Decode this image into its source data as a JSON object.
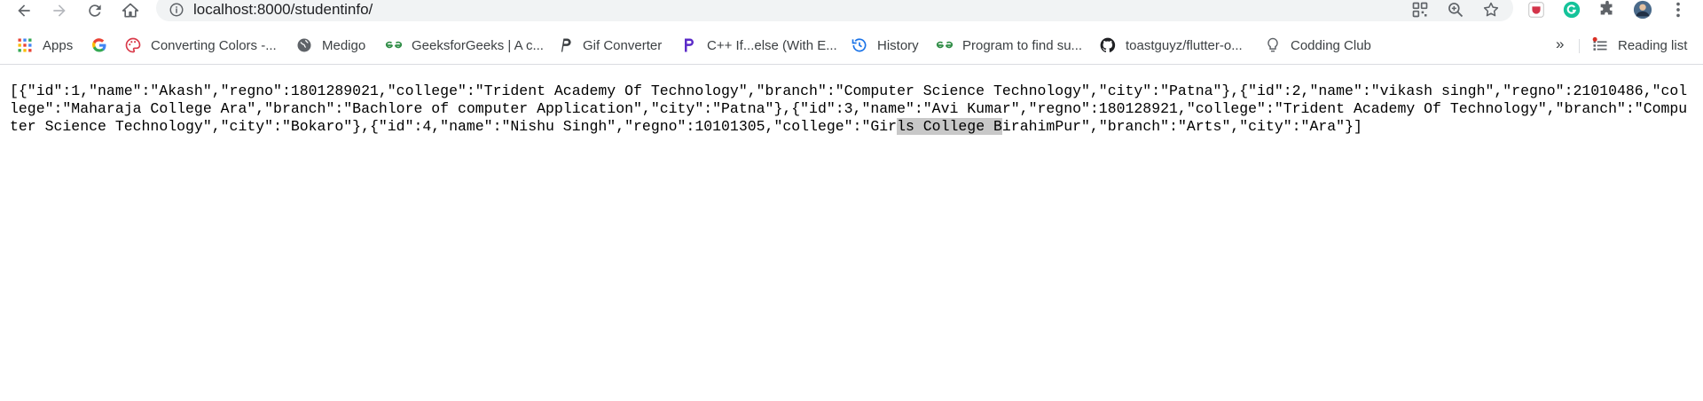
{
  "browser": {
    "url": "localhost:8000/studentinfo/",
    "icons": {
      "back": "back-arrow-icon",
      "forward": "forward-arrow-icon",
      "reload": "reload-icon",
      "home": "home-icon",
      "site_info": "info-icon",
      "apps_grid": "qr-code-icon",
      "zoom": "zoom-icon",
      "bookmark_star": "star-icon",
      "extensions": "puzzle-icon",
      "menu": "kebab-menu-icon"
    }
  },
  "bookmarks": [
    {
      "label": "Apps",
      "icon": "apps-grid-icon"
    },
    {
      "label": "",
      "icon": "google-icon"
    },
    {
      "label": "Converting Colors -...",
      "icon": "palette-icon"
    },
    {
      "label": "Medigo",
      "icon": "globe-icon"
    },
    {
      "label": "GeeksforGeeks | A c...",
      "icon": "gfg-icon"
    },
    {
      "label": "Gif Converter",
      "icon": "p-logo-icon"
    },
    {
      "label": "C++ If...else (With E...",
      "icon": "programiz-icon"
    },
    {
      "label": "History",
      "icon": "history-icon"
    },
    {
      "label": "Program to find su...",
      "icon": "gfg-icon"
    },
    {
      "label": "toastguyz/flutter-o...",
      "icon": "github-icon"
    },
    {
      "label": "Codding Club",
      "icon": "bulb-icon"
    }
  ],
  "bookmarks_more": "»",
  "reading_list": "Reading list",
  "content": {
    "before_selection": "[{\"id\":1,\"name\":\"Akash\",\"regno\":1801289021,\"college\":\"Trident Academy Of Technology\",\"branch\":\"Computer Science Technology\",\"city\":\"Patna\"},{\"id\":2,\"name\":\"vikash singh\",\"regno\":21010486,\"college\":\"Maharaja College Ara\",\"branch\":\"Bachlore of computer Application\",\"city\":\"Patna\"},{\"id\":3,\"name\":\"Avi Kumar\",\"regno\":180128921,\"college\":\"Trident Academy Of Technology\",\"branch\":\"Computer Science Technology\",\"city\":\"Bokaro\"},{\"id\":4,\"name\":\"Nishu Singh\",\"regno\":10101305,\"college\":\"Gir",
    "selection": "ls College B",
    "after_selection": "irahimPur\",\"branch\":\"Arts\",\"city\":\"Ara\"}]"
  }
}
